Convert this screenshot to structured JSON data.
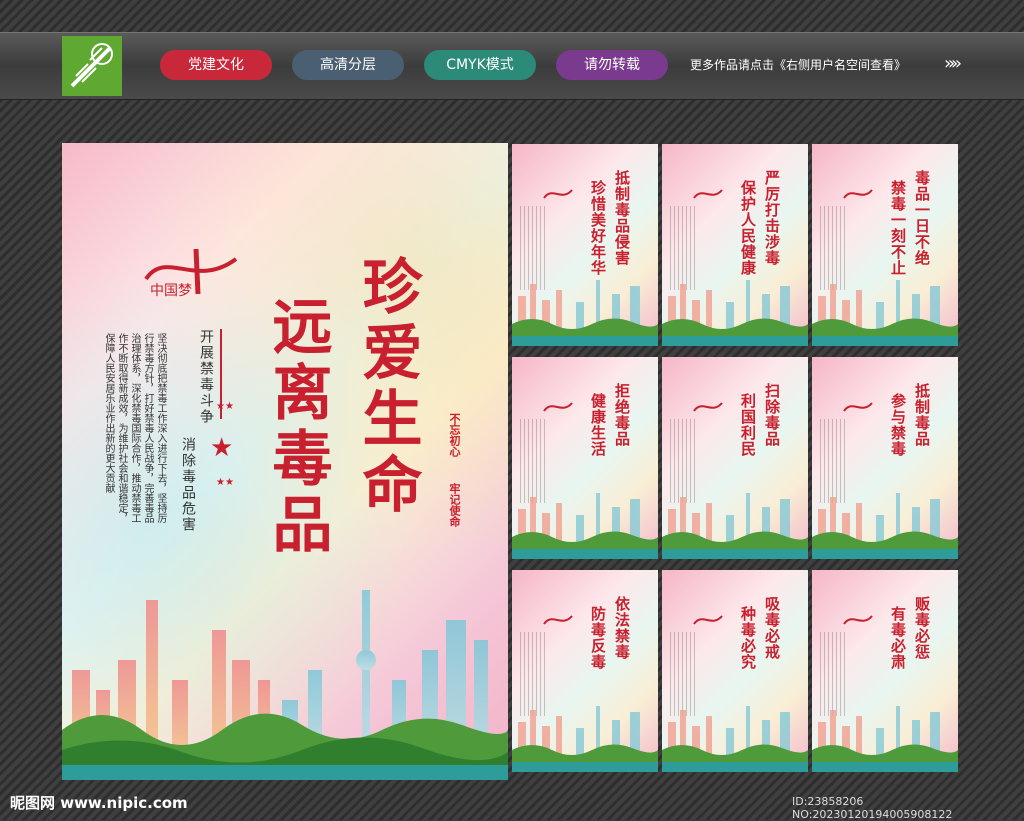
{
  "topbar": {
    "tags": [
      "党建文化",
      "高清分层",
      "CMYK模式",
      "请勿转载"
    ],
    "more_text": "更多作品请点击《右侧用户名空间查看》",
    "arrow": "»»"
  },
  "main_poster": {
    "title_1": "珍爱生命",
    "title_2": "远离毒品",
    "subtitle_1": "开展禁毒斗争",
    "subtitle_2": "消除毒品危害",
    "body": "坚决彻底把禁毒工作深入进行下去，坚持厉行禁毒方针，打好禁毒人民战争，完善毒品治理体系，深化禁毒国际合作，推动禁毒工作不断取得新成效，为维护社会和谐稳定，保障人民安居乐业作出新的更大贡献",
    "badge_1": "不忘初心",
    "badge_2": "牢记使命",
    "logo_text": "中国梦"
  },
  "small_posters": [
    {
      "lines": [
        "抵制毒品侵害",
        "珍惜美好年华"
      ]
    },
    {
      "lines": [
        "严厉打击涉毒",
        "保护人民健康"
      ]
    },
    {
      "lines": [
        "毒品一日不绝",
        "禁毒一刻不止"
      ]
    },
    {
      "lines": [
        "拒绝毒品",
        "健康生活"
      ]
    },
    {
      "lines": [
        "扫除毒品",
        "利国利民"
      ]
    },
    {
      "lines": [
        "抵制毒品",
        "参与禁毒"
      ]
    },
    {
      "lines": [
        "依法禁毒",
        "防毒反毒"
      ]
    },
    {
      "lines": [
        "吸毒必戒",
        "种毒必究"
      ]
    },
    {
      "lines": [
        "贩毒必惩",
        "有毒必肃"
      ]
    }
  ],
  "footer": {
    "site": "昵图网 www.nipic.com",
    "id": "ID:23858206 NO:20230120194005908122"
  }
}
